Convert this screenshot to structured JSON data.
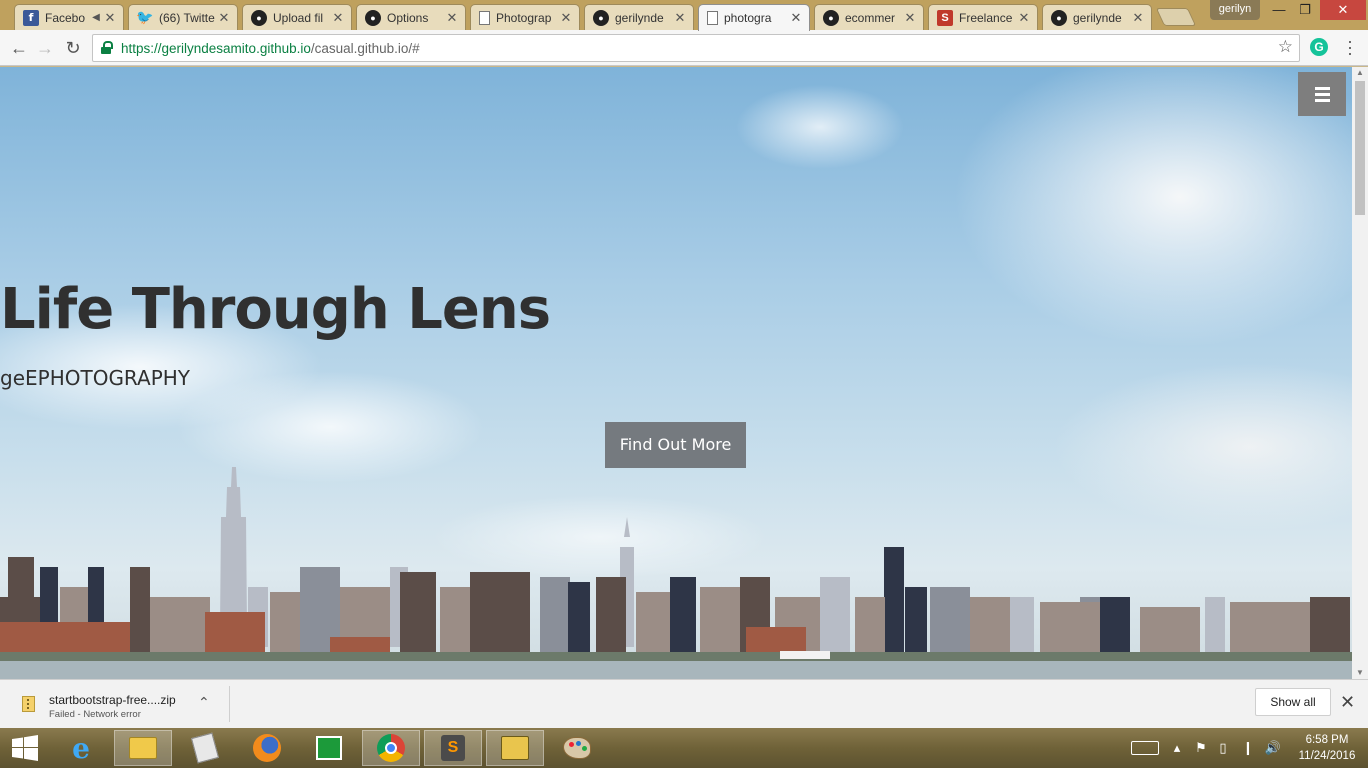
{
  "browser": {
    "tabs": [
      {
        "title": "Facebo",
        "favicon": "facebook-icon",
        "has_audio": true
      },
      {
        "title": "(66) Twitte",
        "favicon": "twitter-icon"
      },
      {
        "title": "Upload fil",
        "favicon": "github-icon"
      },
      {
        "title": "Options",
        "favicon": "github-icon"
      },
      {
        "title": "Photograp",
        "favicon": "page-icon"
      },
      {
        "title": "gerilynde",
        "favicon": "github-icon"
      },
      {
        "title": "photogra",
        "favicon": "page-icon",
        "active": true
      },
      {
        "title": "ecommer",
        "favicon": "github-icon"
      },
      {
        "title": "Freelance",
        "favicon": "freelancer-icon"
      },
      {
        "title": "gerilynde",
        "favicon": "github-icon"
      }
    ],
    "profile_name": "gerilyn",
    "url_secure": "https://gerilyndesamito.github.io",
    "url_rest": "/casual.github.io/#",
    "extension_letter": "G"
  },
  "page": {
    "title": "Life Through Lens",
    "subtitle": "geEPHOTOGRAPHY",
    "cta_label": "Find Out More"
  },
  "downloads": {
    "filename": "startbootstrap-free....zip",
    "status": "Failed - Network error",
    "show_all_label": "Show all"
  },
  "taskbar": {
    "time": "6:58 PM",
    "date": "11/24/2016",
    "apps": [
      "start-icon",
      "internet-explorer-icon",
      "file-explorer-icon",
      "notepad-icon",
      "firefox-icon",
      "store-icon",
      "chrome-icon",
      "sublime-text-icon",
      "app-icon",
      "paint-icon"
    ]
  },
  "colors": {
    "tab_strip": "#bfa15e",
    "secure_green": "#0b8043",
    "hero_button": "#757a7f",
    "hero_text": "#303030"
  }
}
